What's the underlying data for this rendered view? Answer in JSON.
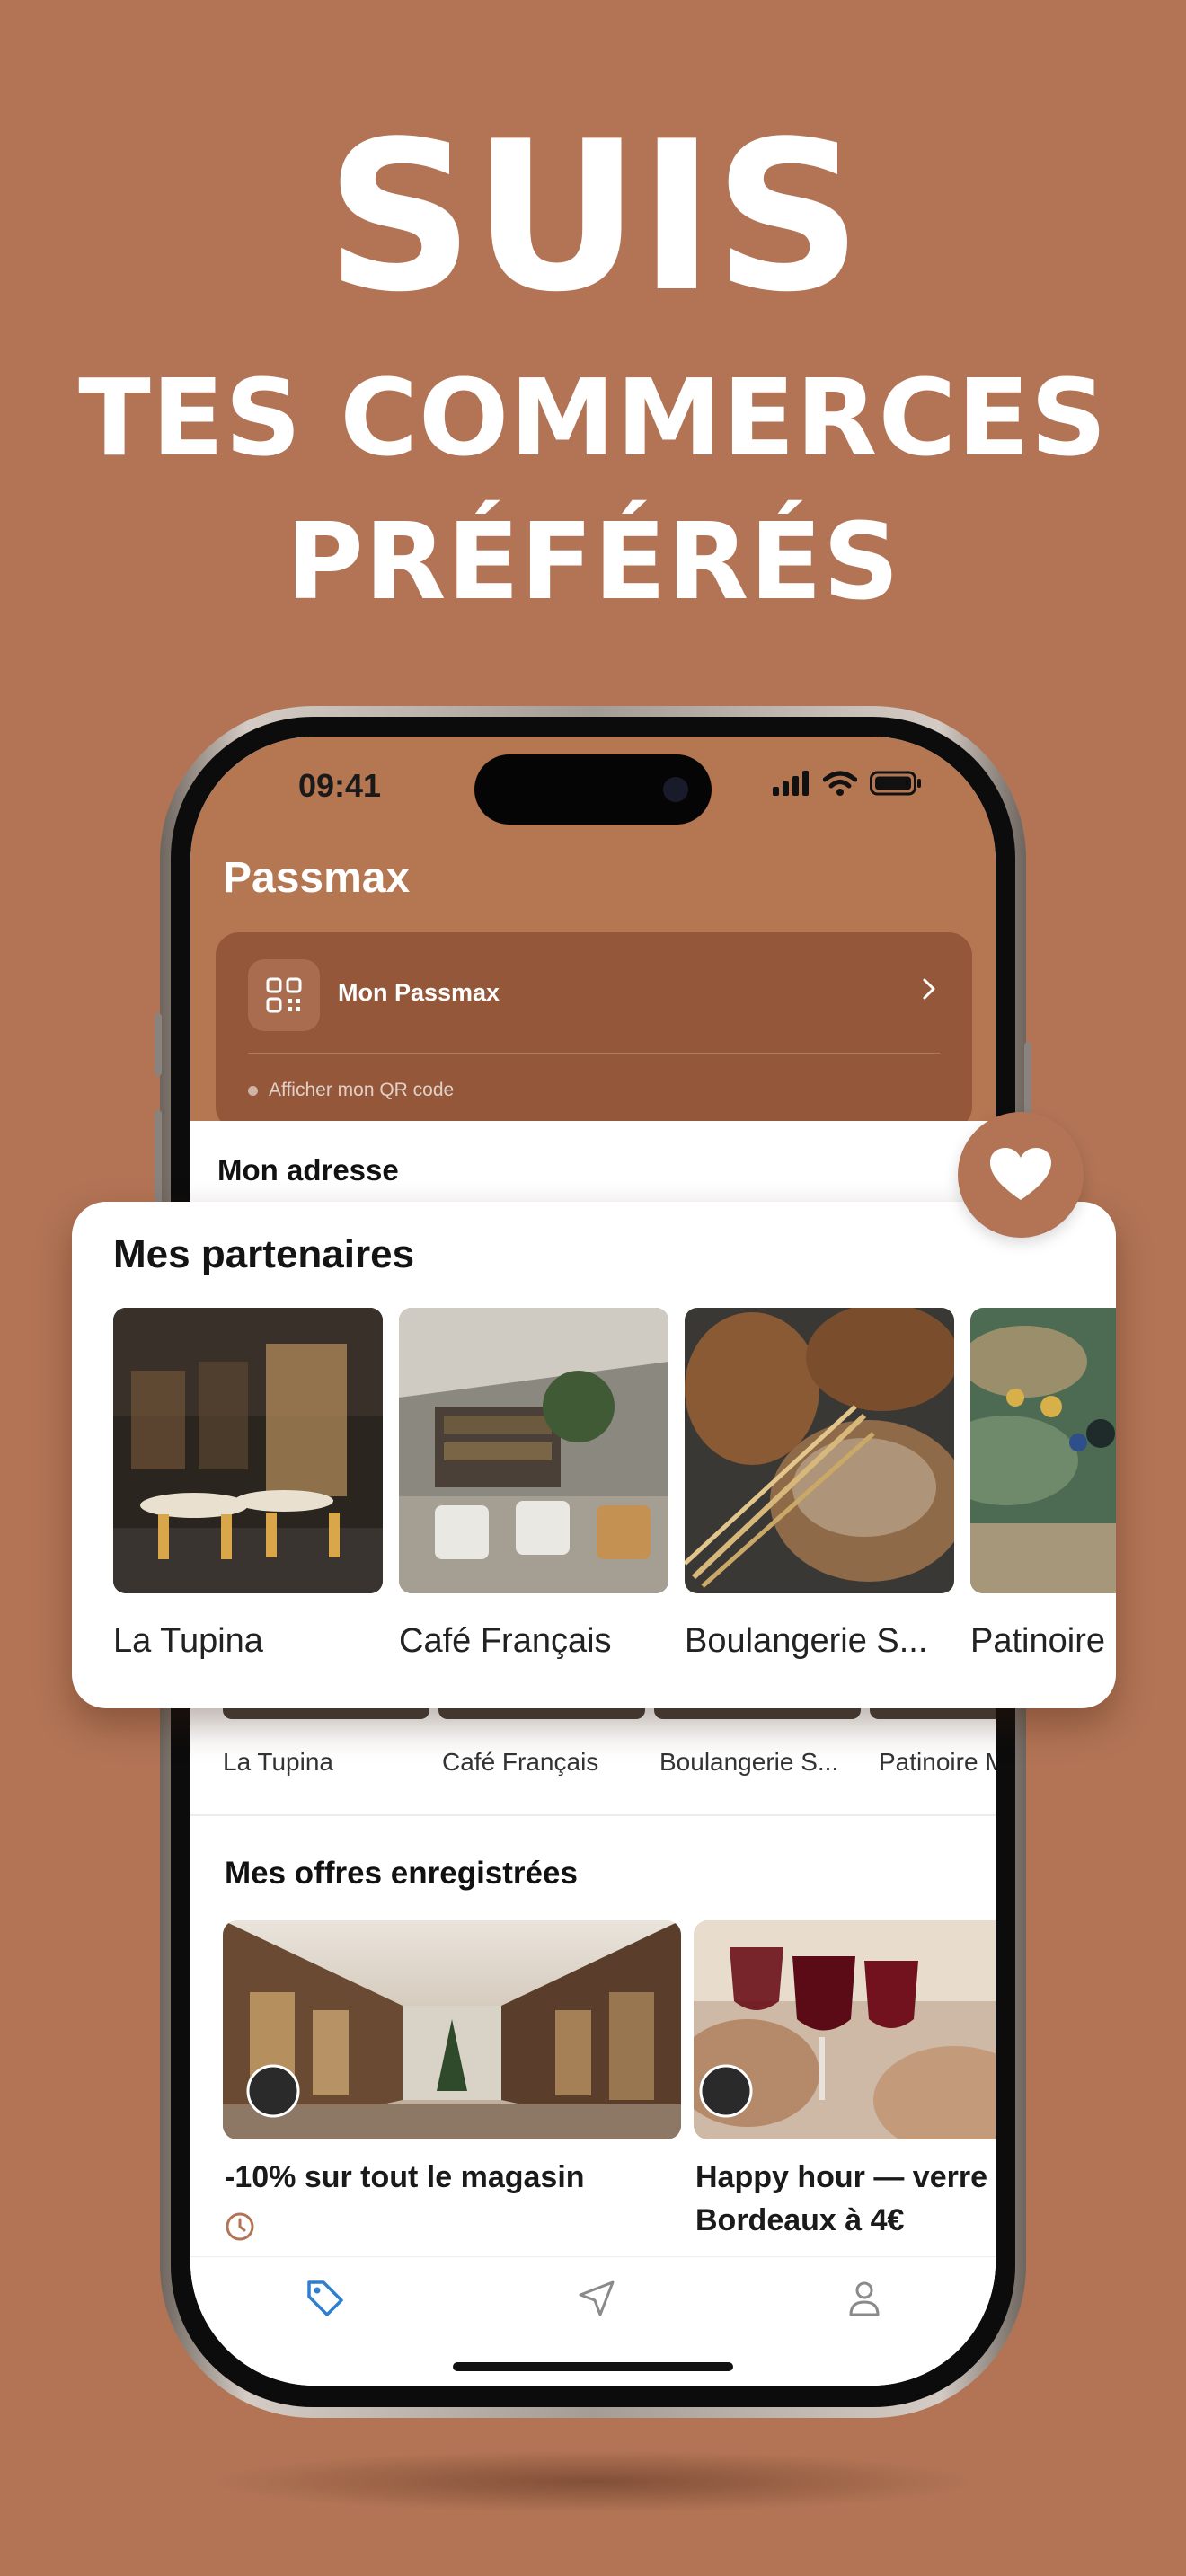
{
  "hero": {
    "line1": "SUIS",
    "line2": "TES COMMERCES",
    "line3": "PRÉFÉRÉS"
  },
  "status": {
    "time": "09:41"
  },
  "app": {
    "title": "Passmax"
  },
  "pass_card": {
    "label": "Mon Passmax",
    "qr_link": "Afficher mon QR code"
  },
  "address": {
    "label": "Mon adresse"
  },
  "partners": {
    "title": "Mes partenaires",
    "items": [
      {
        "name": "La Tupina",
        "image": "restaurant-interior"
      },
      {
        "name": "Café Français",
        "image": "cafe-interior"
      },
      {
        "name": "Boulangerie S...",
        "image": "bread-loaves"
      },
      {
        "name": "Patinoire",
        "image": "board-game"
      }
    ]
  },
  "partners_background": [
    "La Tupina",
    "Café Français",
    "Boulangerie S...",
    "Patinoire M"
  ],
  "offers": {
    "title": "Mes offres enregistrées",
    "items": [
      {
        "title": "-10% sur tout le magasin",
        "image": "shopping-arcade"
      },
      {
        "title_line1": "Happy hour — verre",
        "title_line2": "Bordeaux à 4€",
        "image": "wine-glasses"
      }
    ]
  },
  "tabbar": {
    "items": [
      "tag-icon",
      "navigation-icon",
      "user-icon"
    ],
    "active": "tag-icon",
    "active_color": "#2f7fd0"
  },
  "colors": {
    "background": "#b27455",
    "header": "#b57652",
    "card": "#94573a"
  }
}
